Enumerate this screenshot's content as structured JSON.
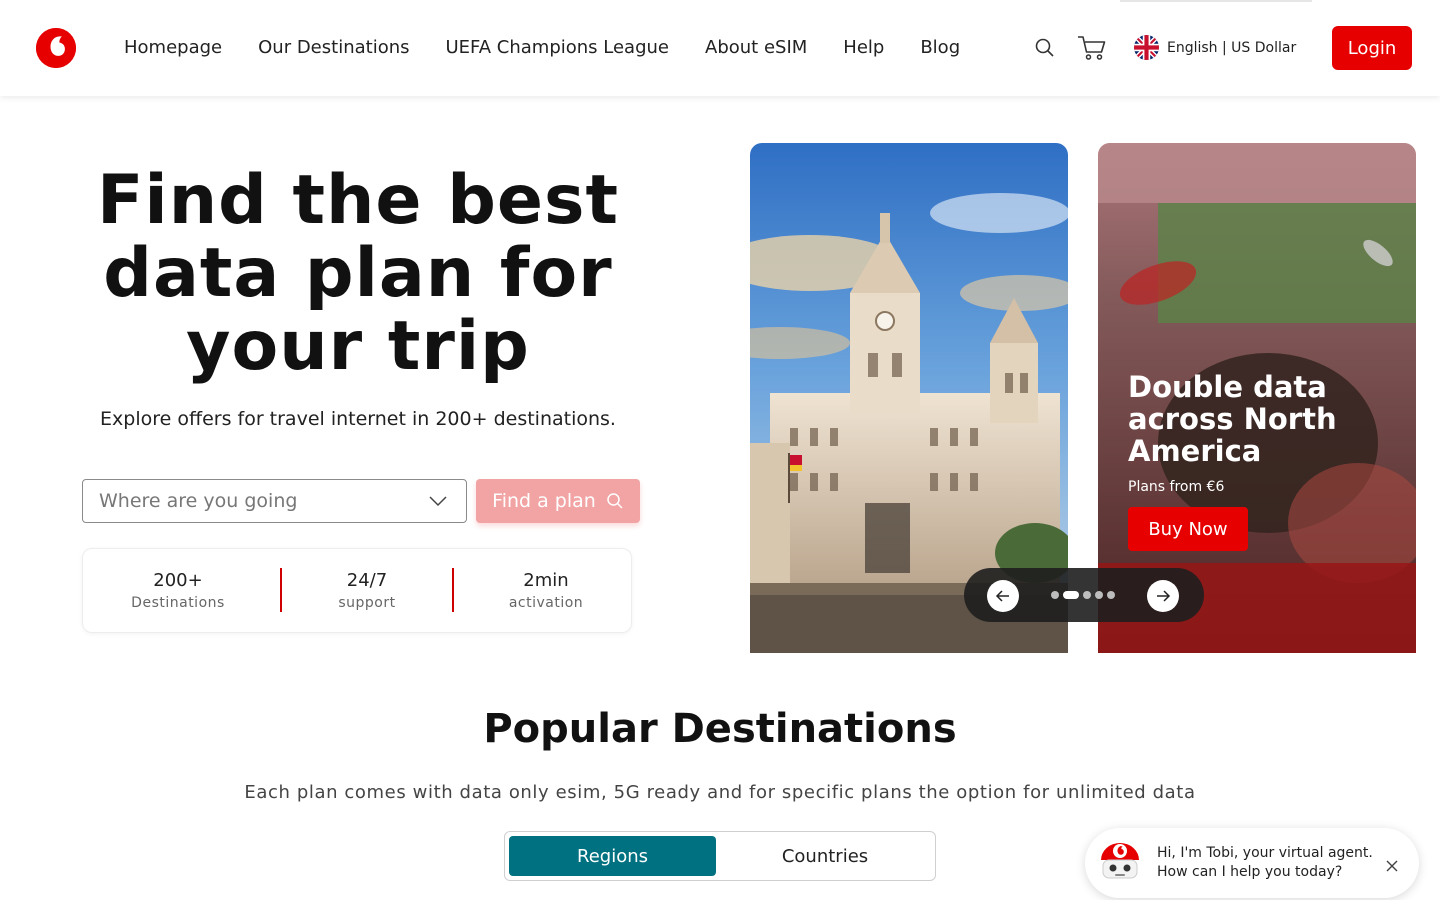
{
  "header": {
    "logo_name": "vodafone-logo",
    "nav": [
      "Homepage",
      "Our Destinations",
      "UEFA Champions League",
      "About eSIM",
      "Help",
      "Blog"
    ],
    "language_label": "English | US Dollar",
    "login_label": "Login",
    "brand_color": "#e60000"
  },
  "hero": {
    "title": "Find the best data plan for your trip",
    "subtitle": "Explore offers for travel internet in 200+ destinations.",
    "select_placeholder": "Where are you going",
    "find_label": "Find a plan",
    "stats": [
      {
        "value": "200+",
        "label": "Destinations"
      },
      {
        "value": "24/7",
        "label": "support"
      },
      {
        "value": "2min",
        "label": "activation"
      }
    ]
  },
  "carousel": {
    "promo_title": "Double data across North America",
    "promo_price": "Plans from €6",
    "promo_button": "Buy Now",
    "slide_count": 5,
    "active_slide": 2
  },
  "popular": {
    "title": "Popular Destinations",
    "subtitle": "Each plan comes with data only esim, 5G ready and for specific plans the option for unlimited data",
    "tabs": [
      "Regions",
      "Countries"
    ],
    "active_tab": "Regions",
    "accent_color": "#007180"
  },
  "chat": {
    "line1": "Hi, I'm Tobi, your virtual agent.",
    "line2": "How can I help you today?"
  }
}
